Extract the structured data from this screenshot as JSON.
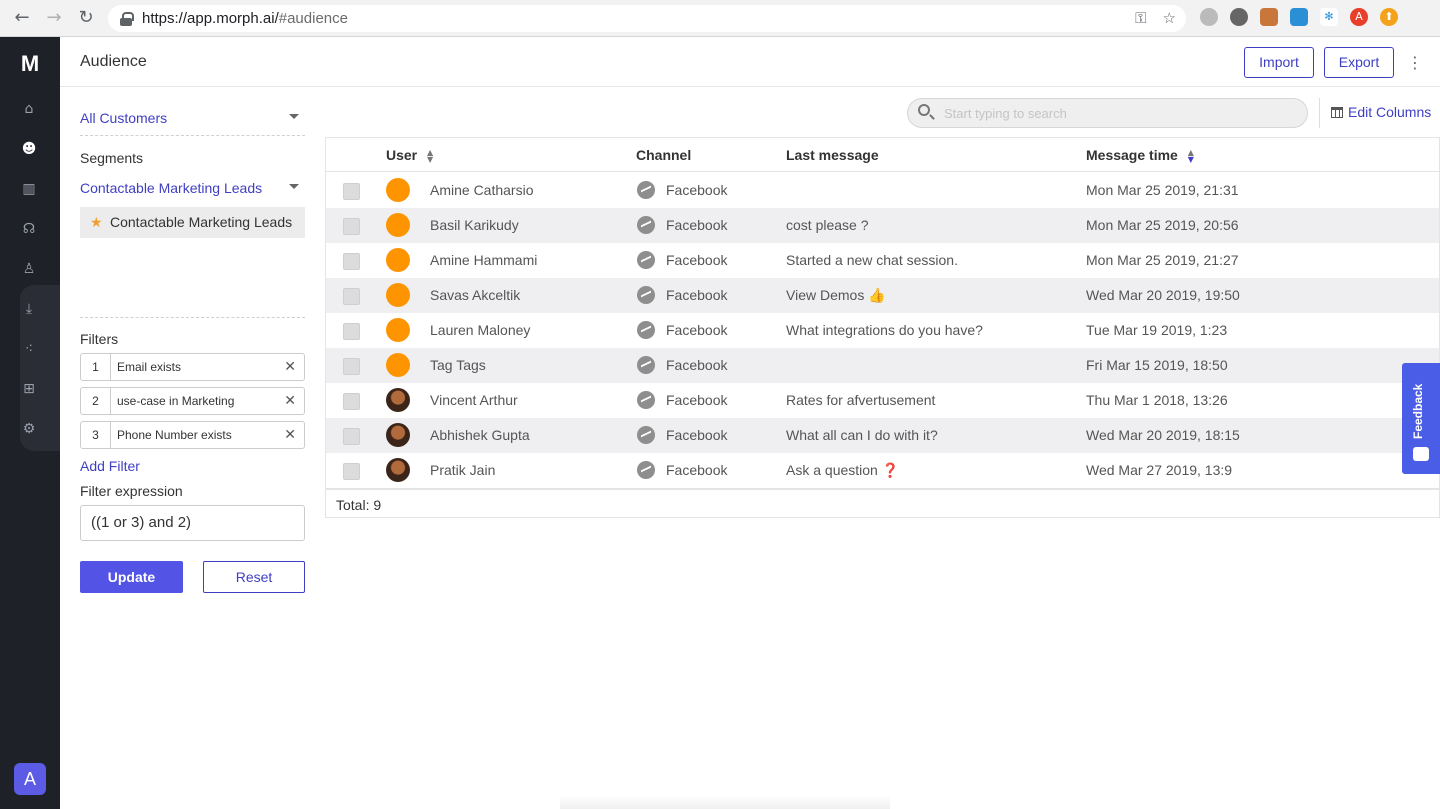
{
  "browser": {
    "url_prefix": "https://app.morph.ai/",
    "url_hash": "#audience"
  },
  "rail": {
    "logo": "M",
    "items": [
      "home-icon",
      "audience-icon",
      "analytics-icon",
      "broadcast-icon",
      "profile-icon",
      "download-icon",
      "integrations-icon",
      "flow-icon",
      "settings-icon"
    ],
    "avatar_letter": "A"
  },
  "header": {
    "title": "Audience",
    "import_label": "Import",
    "export_label": "Export"
  },
  "sidebar": {
    "customers_dropdown": "All Customers",
    "segments_label": "Segments",
    "segment_dropdown": "Contactable Marketing Leads",
    "selected_segment": "Contactable Marketing Leads",
    "filters_label": "Filters",
    "filters": [
      {
        "num": "1",
        "text": "Email exists"
      },
      {
        "num": "2",
        "text": "use-case in Marketing"
      },
      {
        "num": "3",
        "text": "Phone Number exists"
      }
    ],
    "add_filter_label": "Add Filter",
    "expression_label": "Filter expression",
    "expression_value": "((1 or 3) and 2)",
    "update_label": "Update",
    "reset_label": "Reset"
  },
  "search": {
    "placeholder": "Start typing to search"
  },
  "edit_columns_label": "Edit Columns",
  "table": {
    "columns": [
      "User",
      "Channel",
      "Last message",
      "Message time"
    ],
    "rows": [
      {
        "user": "Amine Catharsio",
        "channel": "Facebook",
        "message": "",
        "time": "Mon Mar 25 2019, 21:31",
        "avatar": "orange"
      },
      {
        "user": "Basil Karikudy",
        "channel": "Facebook",
        "message": "cost please ?",
        "time": "Mon Mar 25 2019, 20:56",
        "avatar": "orange"
      },
      {
        "user": "Amine Hammami",
        "channel": "Facebook",
        "message": "Started a new chat session.",
        "time": "Mon Mar 25 2019, 21:27",
        "avatar": "orange"
      },
      {
        "user": "Savas Akceltik",
        "channel": "Facebook",
        "message": "View Demos 👍",
        "time": "Wed Mar 20 2019, 19:50",
        "avatar": "orange"
      },
      {
        "user": "Lauren Maloney",
        "channel": "Facebook",
        "message": "What integrations do you have?",
        "time": "Tue Mar 19 2019, 1:23",
        "avatar": "orange"
      },
      {
        "user": "Tag Tags",
        "channel": "Facebook",
        "message": "",
        "time": "Fri Mar 15 2019, 18:50",
        "avatar": "orange"
      },
      {
        "user": "Vincent Arthur",
        "channel": "Facebook",
        "message": "Rates for afvertusement",
        "time": "Thu Mar 1 2018, 13:26",
        "avatar": "photo"
      },
      {
        "user": "Abhishek Gupta",
        "channel": "Facebook",
        "message": "What all can I do with it?",
        "time": "Wed Mar 20 2019, 18:15",
        "avatar": "photo"
      },
      {
        "user": "Pratik Jain",
        "channel": "Facebook",
        "message": "Ask a question ❓",
        "time": "Wed Mar 27 2019, 13:9",
        "avatar": "photo"
      }
    ],
    "total_label": "Total: 9"
  },
  "feedback_label": "Feedback",
  "colors": {
    "accent": "#3f3fc4",
    "primary_button": "#5353e6",
    "rail": "#1f2128",
    "avatar_orange": "#fe9400",
    "feedback": "#4a5de6"
  }
}
